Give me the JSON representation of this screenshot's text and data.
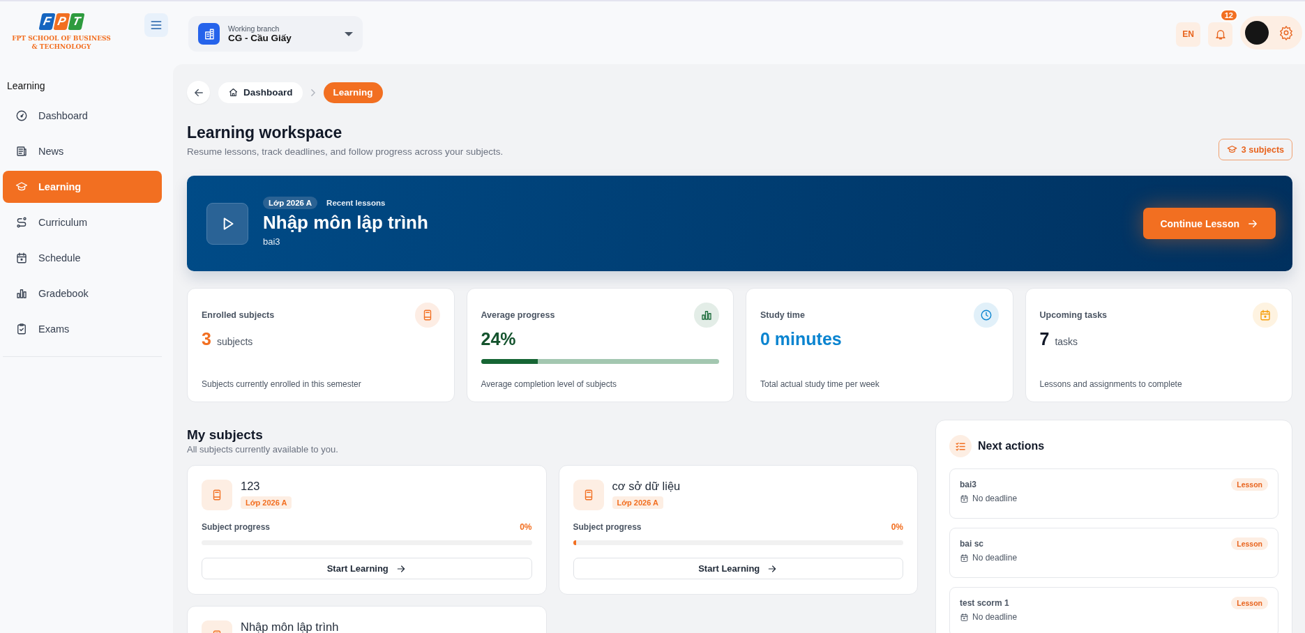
{
  "sidebar": {
    "logo": {
      "letters": [
        {
          "text": "F",
          "color": "#1565c0"
        },
        {
          "text": "P",
          "color": "#f26f21"
        },
        {
          "text": "T",
          "color": "#2e9b3e"
        }
      ],
      "line1": "FPT SCHOOL OF BUSINESS",
      "line2": "& TECHNOLOGY"
    },
    "section": "Learning",
    "items": [
      {
        "label": "Dashboard",
        "selected": false
      },
      {
        "label": "News",
        "selected": false
      },
      {
        "label": "Learning",
        "selected": true
      },
      {
        "label": "Curriculum",
        "selected": false
      },
      {
        "label": "Schedule",
        "selected": false
      },
      {
        "label": "Gradebook",
        "selected": false
      },
      {
        "label": "Exams",
        "selected": false
      }
    ]
  },
  "topbar": {
    "branch": {
      "label": "Working branch",
      "value": "CG - Cầu Giấy"
    },
    "language": "EN",
    "notifications": "12"
  },
  "breadcrumbs": [
    {
      "label": "Dashboard",
      "selected": false
    },
    {
      "label": "Learning",
      "selected": true
    }
  ],
  "page": {
    "title": "Learning workspace",
    "subtitle": "Resume lessons, track deadlines, and follow progress across your subjects.",
    "subjects_badge": "3 subjects"
  },
  "hero": {
    "tag": "Lớp 2026 A",
    "section": "Recent lessons",
    "title": "Nhập môn lập trình",
    "lesson": "bai3",
    "button": "Continue Lesson"
  },
  "stats": [
    {
      "label": "Enrolled subjects",
      "value": "3",
      "unit": "subjects",
      "caption": "Subjects currently enrolled in this semester",
      "color": "#f26f21"
    },
    {
      "label": "Average progress",
      "value": "24%",
      "caption": "Average completion level of subjects",
      "color": "#1b6b3a",
      "level": 0.24
    },
    {
      "label": "Study time",
      "value": "0 minutes",
      "caption": "Total actual study time per week",
      "color": "#0a84d0"
    },
    {
      "label": "Upcoming tasks",
      "value": "7",
      "unit": "tasks",
      "caption": "Lessons and assignments to complete",
      "color": "#f59e0b"
    }
  ],
  "subjects": {
    "title": "My subjects",
    "subtitle": "All subjects currently available to you.",
    "items": [
      {
        "name": "123",
        "tag": "Lớp 2026 A",
        "progress_label": "Subject progress",
        "percent": "0%",
        "level": 0,
        "button": "Start Learning"
      },
      {
        "name": "cơ sở dữ liệu",
        "tag": "Lớp 2026 A",
        "progress_label": "Subject progress",
        "percent": "0%",
        "level": 0.01,
        "button": "Start Learning"
      },
      {
        "name": "Nhập môn lập trình"
      }
    ]
  },
  "next_actions": {
    "title": "Next actions",
    "items": [
      {
        "title": "bai3",
        "type": "Lesson",
        "deadline": "No deadline"
      },
      {
        "title": "bai sc",
        "type": "Lesson",
        "deadline": "No deadline"
      },
      {
        "title": "test scorm 1",
        "type": "Lesson",
        "deadline": "No deadline"
      }
    ]
  }
}
